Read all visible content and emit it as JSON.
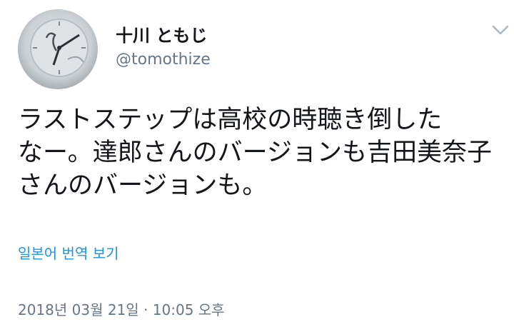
{
  "tweet": {
    "author": {
      "display_name": "十川 ともじ",
      "handle": "@tomothize",
      "avatar_icon": "clock-avatar-icon"
    },
    "menu_icon": "chevron-down-icon",
    "text_lines": [
      "ラストステップは高校の時聴き倒した",
      "なー。達郎さんのバージョンも吉田美奈子",
      "さんのバージョンも。"
    ],
    "translate_label": "일본어 번역 보기",
    "timestamp": "2018년 03월 21일 · 10:05 오후"
  },
  "colors": {
    "text_primary": "#14171a",
    "text_secondary": "#657786",
    "link": "#1b95e0",
    "background": "#ffffff"
  }
}
